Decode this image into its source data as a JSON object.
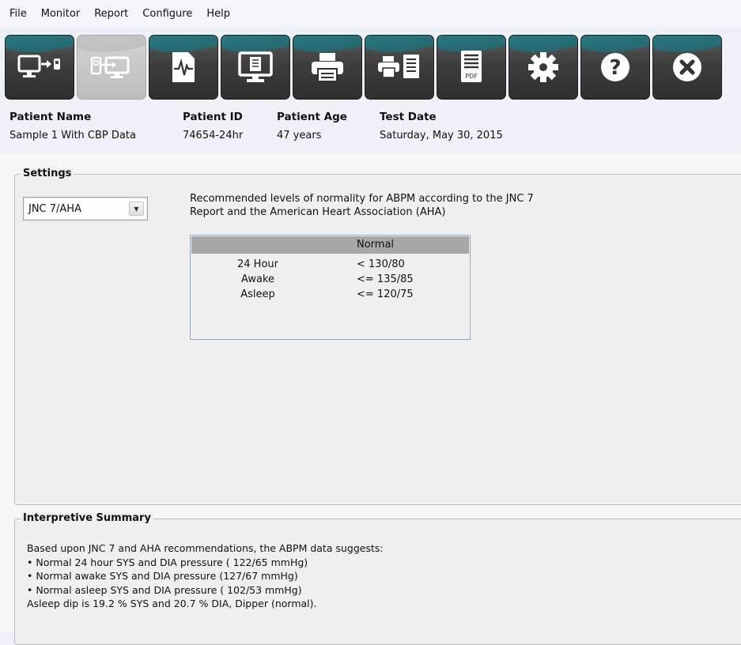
{
  "menu": [
    "File",
    "Monitor",
    "Report",
    "Configure",
    "Help"
  ],
  "toolbar": [
    {
      "icon": "monitor-download-icon",
      "disabled": false
    },
    {
      "icon": "device-transfer-icon",
      "disabled": true
    },
    {
      "icon": "waveform-report-icon",
      "disabled": false
    },
    {
      "icon": "monitor-document-icon",
      "disabled": false
    },
    {
      "icon": "printer-icon",
      "disabled": false
    },
    {
      "icon": "print-pages-icon",
      "disabled": false
    },
    {
      "icon": "pdf-icon",
      "disabled": false
    },
    {
      "icon": "gear-icon",
      "disabled": false
    },
    {
      "icon": "help-icon",
      "disabled": false
    },
    {
      "icon": "close-icon",
      "disabled": false
    }
  ],
  "patient": {
    "name_label": "Patient Name",
    "id_label": "Patient ID",
    "age_label": "Patient Age",
    "date_label": "Test Date",
    "name": "Sample 1 With CBP Data",
    "id": "74654-24hr",
    "age": "47 years",
    "date": "Saturday, May 30, 2015"
  },
  "settings": {
    "legend": "Settings",
    "selected_standard": "JNC 7/AHA",
    "description_line1": "Recommended levels of normality for ABPM according to the JNC 7",
    "description_line2": "Report and the American Heart Association (AHA)",
    "table": {
      "header": "Normal",
      "rows": [
        {
          "label": "24 Hour",
          "value": "<  130/80"
        },
        {
          "label": "Awake",
          "value": "<= 135/85"
        },
        {
          "label": "Asleep",
          "value": "<= 120/75"
        }
      ]
    }
  },
  "summary": {
    "legend": "Interpretive Summary",
    "lines": [
      "Based upon JNC 7 and AHA recommendations, the ABPM data suggests:",
      "• Normal 24 hour SYS and DIA pressure ( 122/65 mmHg)",
      "• Normal awake SYS and DIA pressure (127/67 mmHg)",
      "• Normal asleep SYS and DIA pressure ( 102/53 mmHg)",
      "Asleep dip is 19.2 % SYS and 20.7 % DIA, Dipper (normal)."
    ]
  }
}
